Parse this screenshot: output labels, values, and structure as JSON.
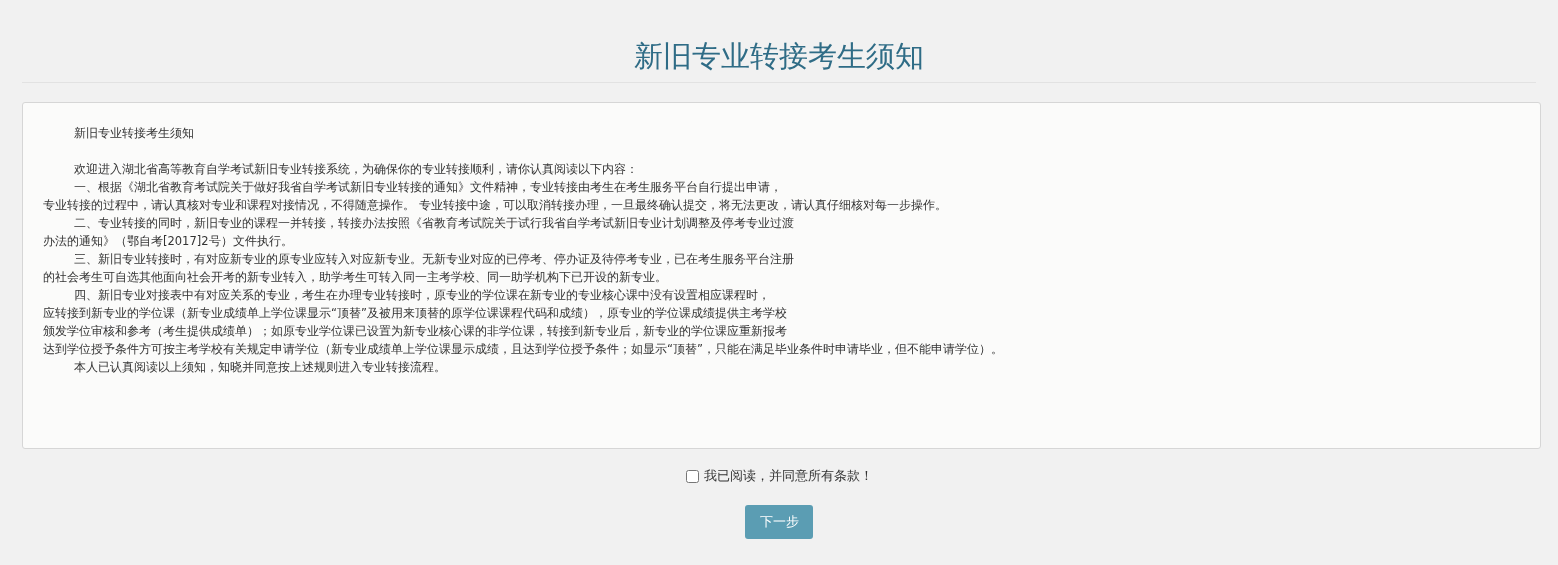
{
  "page_title": "新旧专业转接考生须知",
  "notice": {
    "title": "新旧专业转接考生须知",
    "lines": [
      {
        "kind": "para",
        "text": "欢迎进入湖北省高等教育自学考试新旧专业转接系统，为确保你的专业转接顺利，请你认真阅读以下内容："
      },
      {
        "kind": "para",
        "text": "一、根据《湖北省教育考试院关于做好我省自学考试新旧专业转接的通知》文件精神，专业转接由考生在考生服务平台自行提出申请，"
      },
      {
        "kind": "cont",
        "text": "专业转接的过程中，请认真核对专业和课程对接情况，不得随意操作。 专业转接中途，可以取消转接办理，一旦最终确认提交，将无法更改，请认真仔细核对每一步操作。"
      },
      {
        "kind": "para",
        "text": "二、专业转接的同时，新旧专业的课程一并转接，转接办法按照《省教育考试院关于试行我省自学考试新旧专业计划调整及停考专业过渡"
      },
      {
        "kind": "cont",
        "text": "办法的通知》（鄂自考[2017]2号）文件执行。"
      },
      {
        "kind": "para",
        "text": "三、新旧专业转接时，有对应新专业的原专业应转入对应新专业。无新专业对应的已停考、停办证及待停考专业，已在考生服务平台注册"
      },
      {
        "kind": "cont",
        "text": "的社会考生可自选其他面向社会开考的新专业转入，助学考生可转入同一主考学校、同一助学机构下已开设的新专业。"
      },
      {
        "kind": "para",
        "text": "四、新旧专业对接表中有对应关系的专业，考生在办理专业转接时，原专业的学位课在新专业的专业核心课中没有设置相应课程时，"
      },
      {
        "kind": "cont",
        "text": "应转接到新专业的学位课（新专业成绩单上学位课显示“顶替”及被用来顶替的原学位课课程代码和成绩），原专业的学位课成绩提供主考学校"
      },
      {
        "kind": "cont",
        "text": "颁发学位审核和参考（考生提供成绩单）；如原专业学位课已设置为新专业核心课的非学位课，转接到新专业后，新专业的学位课应重新报考"
      },
      {
        "kind": "cont",
        "text": "达到学位授予条件方可按主考学校有关规定申请学位（新专业成绩单上学位课显示成绩，且达到学位授予条件；如显示“顶替”，只能在满足毕业条件时申请毕业，但不能申请学位）。"
      },
      {
        "kind": "para",
        "text": "本人已认真阅读以上须知，知晓并同意按上述规则进入专业转接流程。"
      }
    ]
  },
  "agree": {
    "label": "我已阅读，并同意所有条款！",
    "checked": false
  },
  "next_button": "下一步"
}
